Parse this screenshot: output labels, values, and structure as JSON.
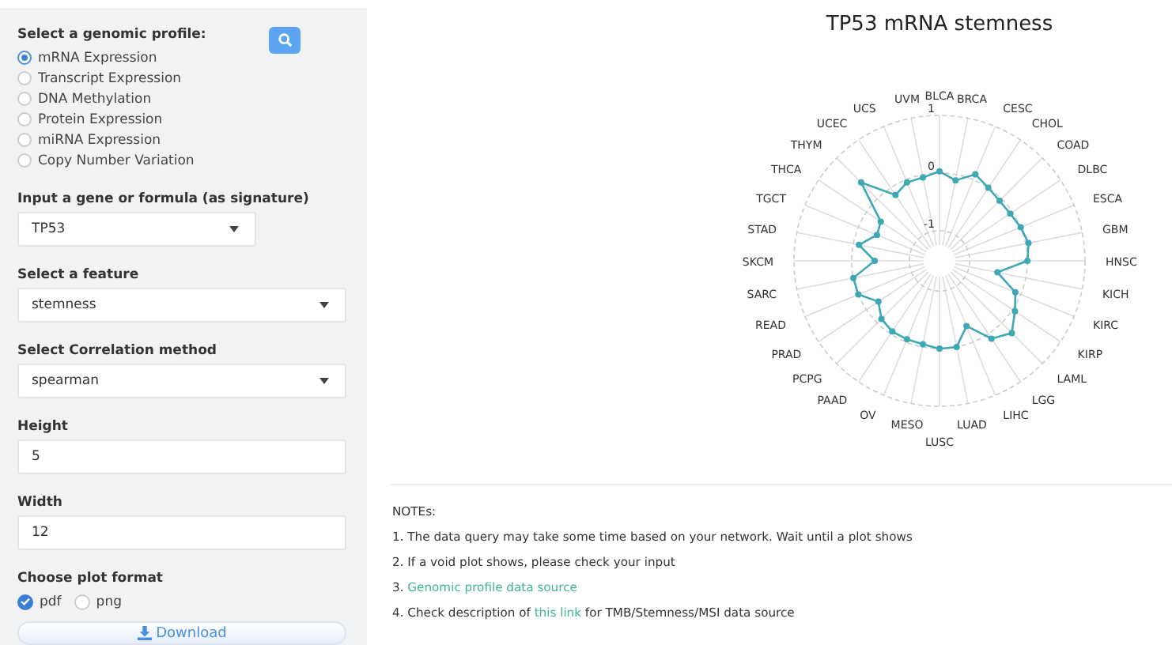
{
  "sidebar": {
    "profile_label": "Select a genomic profile:",
    "profiles": [
      {
        "label": "mRNA Expression",
        "selected": true
      },
      {
        "label": "Transcript Expression",
        "selected": false
      },
      {
        "label": "DNA Methylation",
        "selected": false
      },
      {
        "label": "Protein Expression",
        "selected": false
      },
      {
        "label": "miRNA Expression",
        "selected": false
      },
      {
        "label": "Copy Number Variation",
        "selected": false
      }
    ],
    "fields": [
      {
        "kind": "select",
        "label": "Input a gene or formula (as signature)",
        "value": "TP53"
      },
      {
        "kind": "select",
        "label": "Select a feature",
        "value": "stemness"
      },
      {
        "kind": "select",
        "label": "Select Correlation method",
        "value": "spearman"
      },
      {
        "kind": "number",
        "label": "Height",
        "value": "5"
      },
      {
        "kind": "number",
        "label": "Width",
        "value": "12"
      }
    ],
    "format_label": "Choose plot format",
    "formats": [
      {
        "label": "pdf",
        "selected": true
      },
      {
        "label": "png",
        "selected": false
      }
    ],
    "download": "Download"
  },
  "plot": {
    "title": "TP53 mRNA stemness",
    "labels_right": [
      "BLCA",
      "BRCA",
      "CESC",
      "CHOL",
      "COAD",
      "DLBC",
      "ESCA",
      "GBM",
      "HNSC",
      "KICH",
      "KIRC",
      "KIRP",
      "LAML",
      "LGG",
      "LIHC",
      "LUAD"
    ],
    "labels_left": [
      "UVM",
      "UCS",
      "UCEC",
      "THYM",
      "THCA",
      "TGCT",
      "STAD",
      "SKCM",
      "SARC",
      "READ",
      "PRAD",
      "PCPG",
      "PAAD",
      "OV",
      "MESO",
      "LUSC"
    ],
    "ticks": [
      "1",
      "0",
      "-1"
    ]
  },
  "notes": {
    "title": "NOTEs:",
    "items": [
      {
        "parts": [
          {
            "kind": "text",
            "text": "1. The data query may take some time based on your network. Wait until a plot shows"
          }
        ]
      },
      {
        "parts": [
          {
            "kind": "text",
            "text": "2. If a void plot shows, please check your input"
          }
        ]
      },
      {
        "parts": [
          {
            "kind": "text",
            "text": "3. "
          },
          {
            "kind": "link",
            "text": "Genomic profile data source"
          }
        ]
      },
      {
        "parts": [
          {
            "kind": "text",
            "text": "4. Check description of "
          },
          {
            "kind": "link",
            "text": "this link"
          },
          {
            "kind": "text",
            "text": " for TMB/Stemness/MSI data source"
          }
        ]
      }
    ]
  }
}
